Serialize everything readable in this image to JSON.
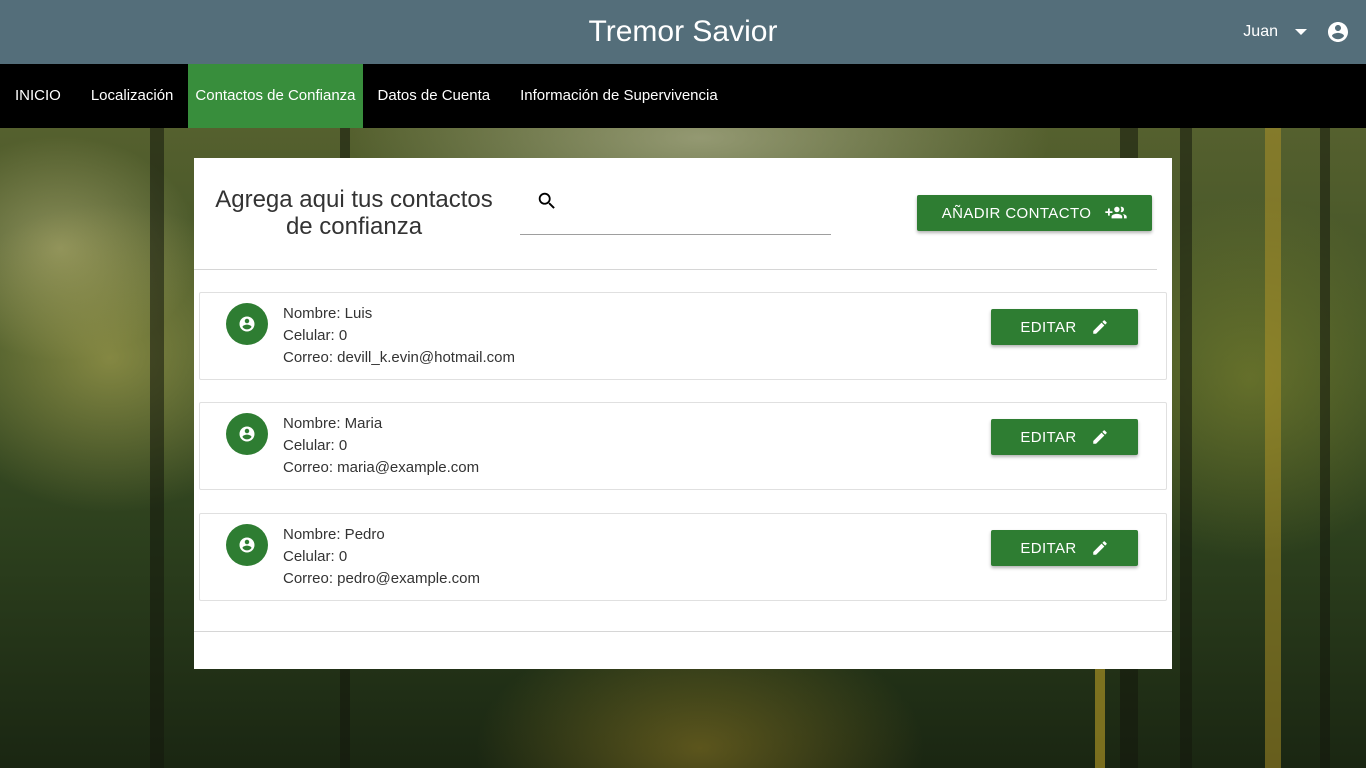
{
  "header": {
    "title": "Tremor Savior",
    "user_name": "Juan"
  },
  "nav": {
    "items": [
      {
        "label": "INICIO"
      },
      {
        "label": "Localización"
      },
      {
        "label": "Contactos de Confianza"
      },
      {
        "label": "Datos de Cuenta"
      },
      {
        "label": "Información de Supervivencia"
      }
    ],
    "active": "Contactos de Confianza"
  },
  "main": {
    "title": "Agrega aqui tus contactos de confianza",
    "search": {
      "value": "",
      "placeholder": ""
    },
    "add_button_label": "AÑADIR CONTACTO",
    "edit_button_label": "EDITAR",
    "contacts": [
      {
        "name": "Nombre: Luis",
        "phone": "Celular: 0",
        "email": "Correo: devill_k.evin@hotmail.com"
      },
      {
        "name": "Nombre: Maria",
        "phone": "Celular: 0",
        "email": "Correo: maria@example.com"
      },
      {
        "name": "Nombre: Pedro",
        "phone": "Celular: 0",
        "email": "Correo: pedro@example.com"
      }
    ]
  },
  "colors": {
    "header_bg": "#546e7a",
    "nav_bg": "#000000",
    "nav_active_bg": "#388e3c",
    "button_bg": "#2e7d32"
  },
  "icons": {
    "user_menu": "arrow-drop-down-icon",
    "account": "account-circle-icon",
    "search": "search-icon",
    "add_contact": "group-add-icon",
    "edit": "pencil-icon",
    "avatar": "account-circle-icon"
  }
}
